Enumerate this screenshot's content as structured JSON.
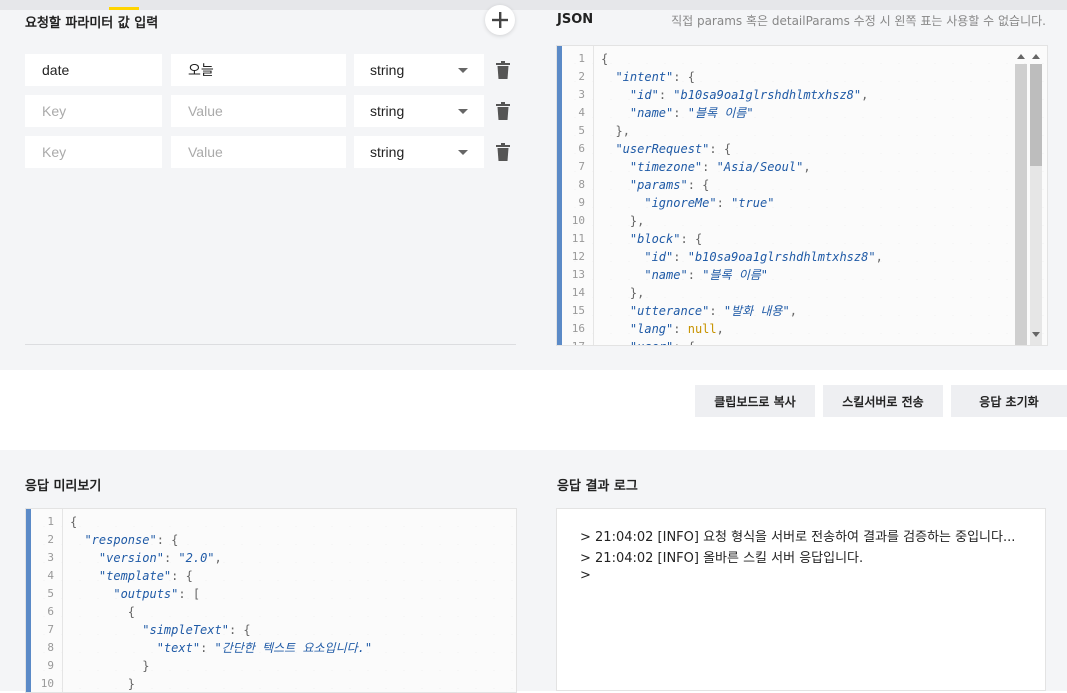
{
  "params_section": {
    "title": "요청할 파라미터 값 입력",
    "rows": [
      {
        "key": "date",
        "value": "오늘",
        "type": "string"
      },
      {
        "key": "",
        "value": "",
        "type": "string"
      },
      {
        "key": "",
        "value": "",
        "type": "string"
      }
    ],
    "key_placeholder": "Key",
    "value_placeholder": "Value"
  },
  "json_section": {
    "title": "JSON",
    "note": "직접 params 혹은 detailParams 수정 시 왼쪽 표는 사용할 수 없습니다."
  },
  "json_lines": [
    "{",
    "  \"intent\": {",
    "    \"id\": \"b10sa9oa1glrshdhlmtxhsz8\",",
    "    \"name\": \"블록 이름\"",
    "  },",
    "  \"userRequest\": {",
    "    \"timezone\": \"Asia/Seoul\",",
    "    \"params\": {",
    "      \"ignoreMe\": \"true\"",
    "    },",
    "    \"block\": {",
    "      \"id\": \"b10sa9oa1glrshdhlmtxhsz8\",",
    "      \"name\": \"블록 이름\"",
    "    },",
    "    \"utterance\": \"발화 내용\",",
    "    \"lang\": null,",
    "    \"user\": {"
  ],
  "actions": {
    "copy": "클립보드로 복사",
    "send": "스킬서버로 전송",
    "reset": "응답 초기화"
  },
  "preview_section": {
    "title": "응답 미리보기",
    "lines": [
      "{",
      "  \"response\": {",
      "    \"version\": \"2.0\",",
      "    \"template\": {",
      "      \"outputs\": [",
      "        {",
      "          \"simpleText\": {",
      "            \"text\": \"간단한 텍스트 요소입니다.\"",
      "          }",
      "        }"
    ]
  },
  "log_section": {
    "title": "응답 결과 로그",
    "lines": [
      "> 21:04:02 [INFO] 요청 형식을 서버로 전송하여 결과를 검증하는 중입니다...",
      "> 21:04:02 [INFO] 올바른 스킬 서버 응답입니다.",
      ">"
    ]
  },
  "colors": {
    "accent_bar": "#5b8ac7",
    "code_key": "#1f5aa6",
    "code_null": "#c79300",
    "highlight": "#ffd400"
  },
  "icons": [
    "plus-icon",
    "chevron-down-icon",
    "trash-icon"
  ]
}
